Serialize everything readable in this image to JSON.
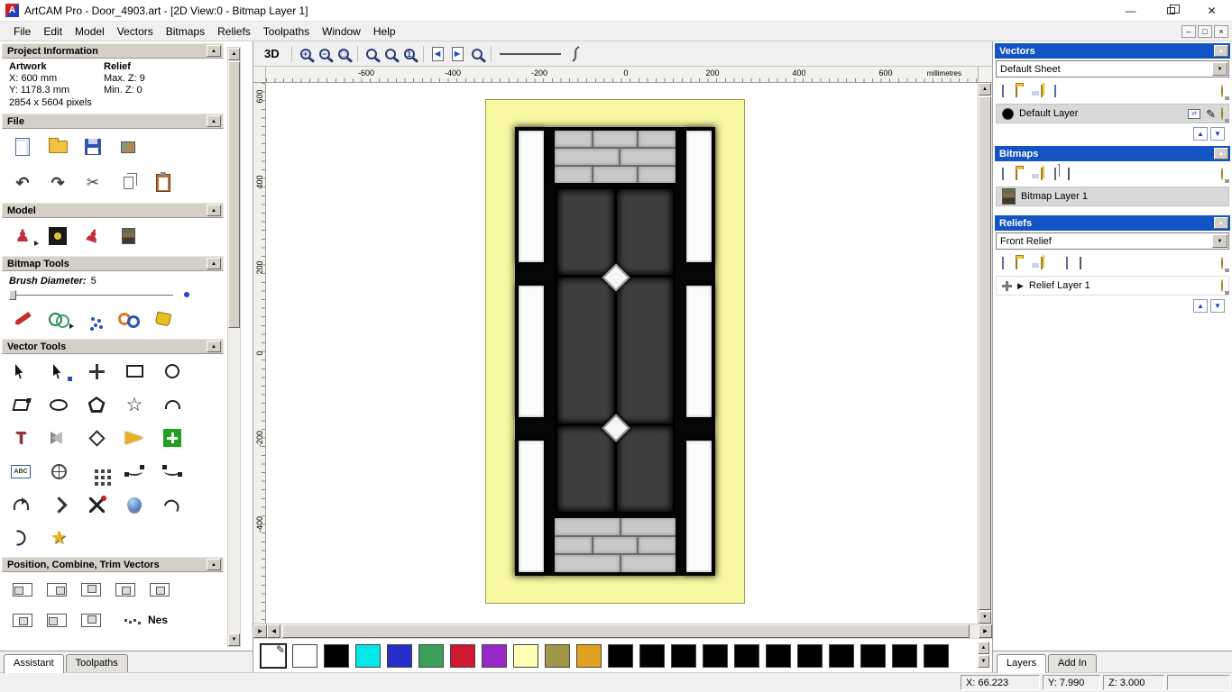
{
  "window": {
    "title": "ArtCAM Pro - Door_4903.art - [2D View:0 - Bitmap Layer 1]"
  },
  "menu": {
    "items": [
      "File",
      "Edit",
      "Model",
      "Vectors",
      "Bitmaps",
      "Reliefs",
      "Toolpaths",
      "Window",
      "Help"
    ]
  },
  "assistant": {
    "project_information": {
      "title": "Project Information",
      "artwork_heading": "Artwork",
      "relief_heading": "Relief",
      "artwork_x": "X: 600 mm",
      "artwork_y": "Y: 1178.3 mm",
      "relief_max": "Max. Z: 9",
      "relief_min": "Min. Z: 0",
      "pixels": "2854 x 5604 pixels"
    },
    "file_section_title": "File",
    "model_section_title": "Model",
    "bitmap_tools_title": "Bitmap Tools",
    "brush_diameter_label": "Brush Diameter:",
    "brush_diameter_value": "5",
    "vector_tools_title": "Vector Tools",
    "position_section_title": "Position, Combine, Trim Vectors",
    "nes_label": "Nes",
    "tabs": [
      "Assistant",
      "Toolpaths"
    ],
    "icons": {
      "file": [
        "new-model-icon",
        "open-model-icon",
        "save-model-icon",
        "import-icon",
        "undo-icon",
        "redo-icon",
        "cut-icon",
        "copy-icon",
        "paste-icon"
      ],
      "model": [
        "model-figure-icon",
        "model-preview-icon",
        "model-pose-icon",
        "model-image-icon"
      ],
      "bitmap_tools": [
        "paint-brush-icon",
        "colour-picker-icon",
        "spray-icon",
        "flood-fill-icon",
        "fill-bucket-icon"
      ],
      "vector_tools": [
        "select-tool-icon",
        "node-editing-tool-icon",
        "transform-tool-icon",
        "create-rectangle-icon",
        "create-circle-icon",
        "create-polyline-icon",
        "create-ellipse-icon",
        "create-polygon-icon",
        "create-star-icon",
        "create-arc-icon",
        "create-text-icon",
        "wrap-text-icon",
        "measure-tool-icon",
        "offset-tool-icon",
        "paste-weave-icon",
        "text-block-icon",
        "texture-wrap-icon",
        "block-copy-icon",
        "fillet-curves-icon",
        "join-curves-icon",
        "arc-fit-icon",
        "polyline-fit-icon",
        "trim-vectors-icon",
        "extrude-tool-icon",
        "spline-tool-icon",
        "mirror-curve-icon",
        "star-wizard-icon"
      ],
      "position": [
        "align-left-icon",
        "align-right-icon",
        "align-top-icon",
        "align-bottom-icon",
        "align-center-icon",
        "combine-icon",
        "subtract-icon",
        "slice-icon",
        "array-icon"
      ]
    }
  },
  "view": {
    "toolbar": {
      "btn_3d": "3D",
      "icons": [
        "zoom-in-icon",
        "zoom-out-icon",
        "zoom-window-icon",
        "zoom-fit-icon",
        "zoom-objects-icon",
        "zoom-scale-icon",
        "previous-view-icon",
        "next-view-icon",
        "zoom-last-icon",
        "line-preview-icon",
        "curve-preview-icon"
      ]
    },
    "ruler": {
      "top_labels": [
        "-600",
        "-400",
        "-200",
        "0",
        "200",
        "400",
        "600"
      ],
      "unit": "millimetres",
      "left_labels": [
        "600",
        "400",
        "200",
        "0",
        "-200",
        "-400"
      ]
    }
  },
  "layers_panel": {
    "vectors": {
      "title": "Vectors",
      "sheet_selector": "Default Sheet",
      "layer_name": "Default Layer",
      "icons": [
        "new-vector-layer-icon",
        "open-vectors-icon",
        "save-vectors-icon",
        "import-vectors-icon",
        "sheet-icon",
        "merge-layers-icon",
        "toggle-all-visibility-icon"
      ]
    },
    "bitmaps": {
      "title": "Bitmaps",
      "layer_name": "Bitmap Layer 1",
      "icons": [
        "new-bitmap-layer-icon",
        "open-bitmap-icon",
        "save-bitmap-icon",
        "import-bitmap-icon",
        "copy-bitmap-icon",
        "preview-bitmap-icon",
        "merge-bitmap-icon",
        "toggle-all-visibility-icon"
      ]
    },
    "reliefs": {
      "title": "Reliefs",
      "relief_selector": "Front Relief",
      "layer_name": "Relief Layer 1",
      "icons": [
        "new-relief-layer-icon",
        "open-relief-icon",
        "save-relief-icon",
        "import-relief-icon",
        "smooth-relief-icon",
        "relief-page-icon",
        "relief-grid-icon",
        "relief-sphere-icon",
        "toggle-all-visibility-icon"
      ]
    },
    "tabs": [
      "Layers",
      "Add In"
    ]
  },
  "palette": {
    "colors": [
      "#ffffff",
      "#ffffff",
      "#000000",
      "#00e8e8",
      "#2630c8",
      "#3ca05a",
      "#d01830",
      "#9828c8",
      "#ffffb4",
      "#a09848",
      "#e0a020",
      "#000000",
      "#000000",
      "#000000",
      "#000000",
      "#000000",
      "#000000",
      "#000000",
      "#000000",
      "#000000",
      "#000000",
      "#000000"
    ]
  },
  "status": {
    "x": "X: 66.223",
    "y": "Y: 7.990",
    "z": "Z: 3.000"
  }
}
